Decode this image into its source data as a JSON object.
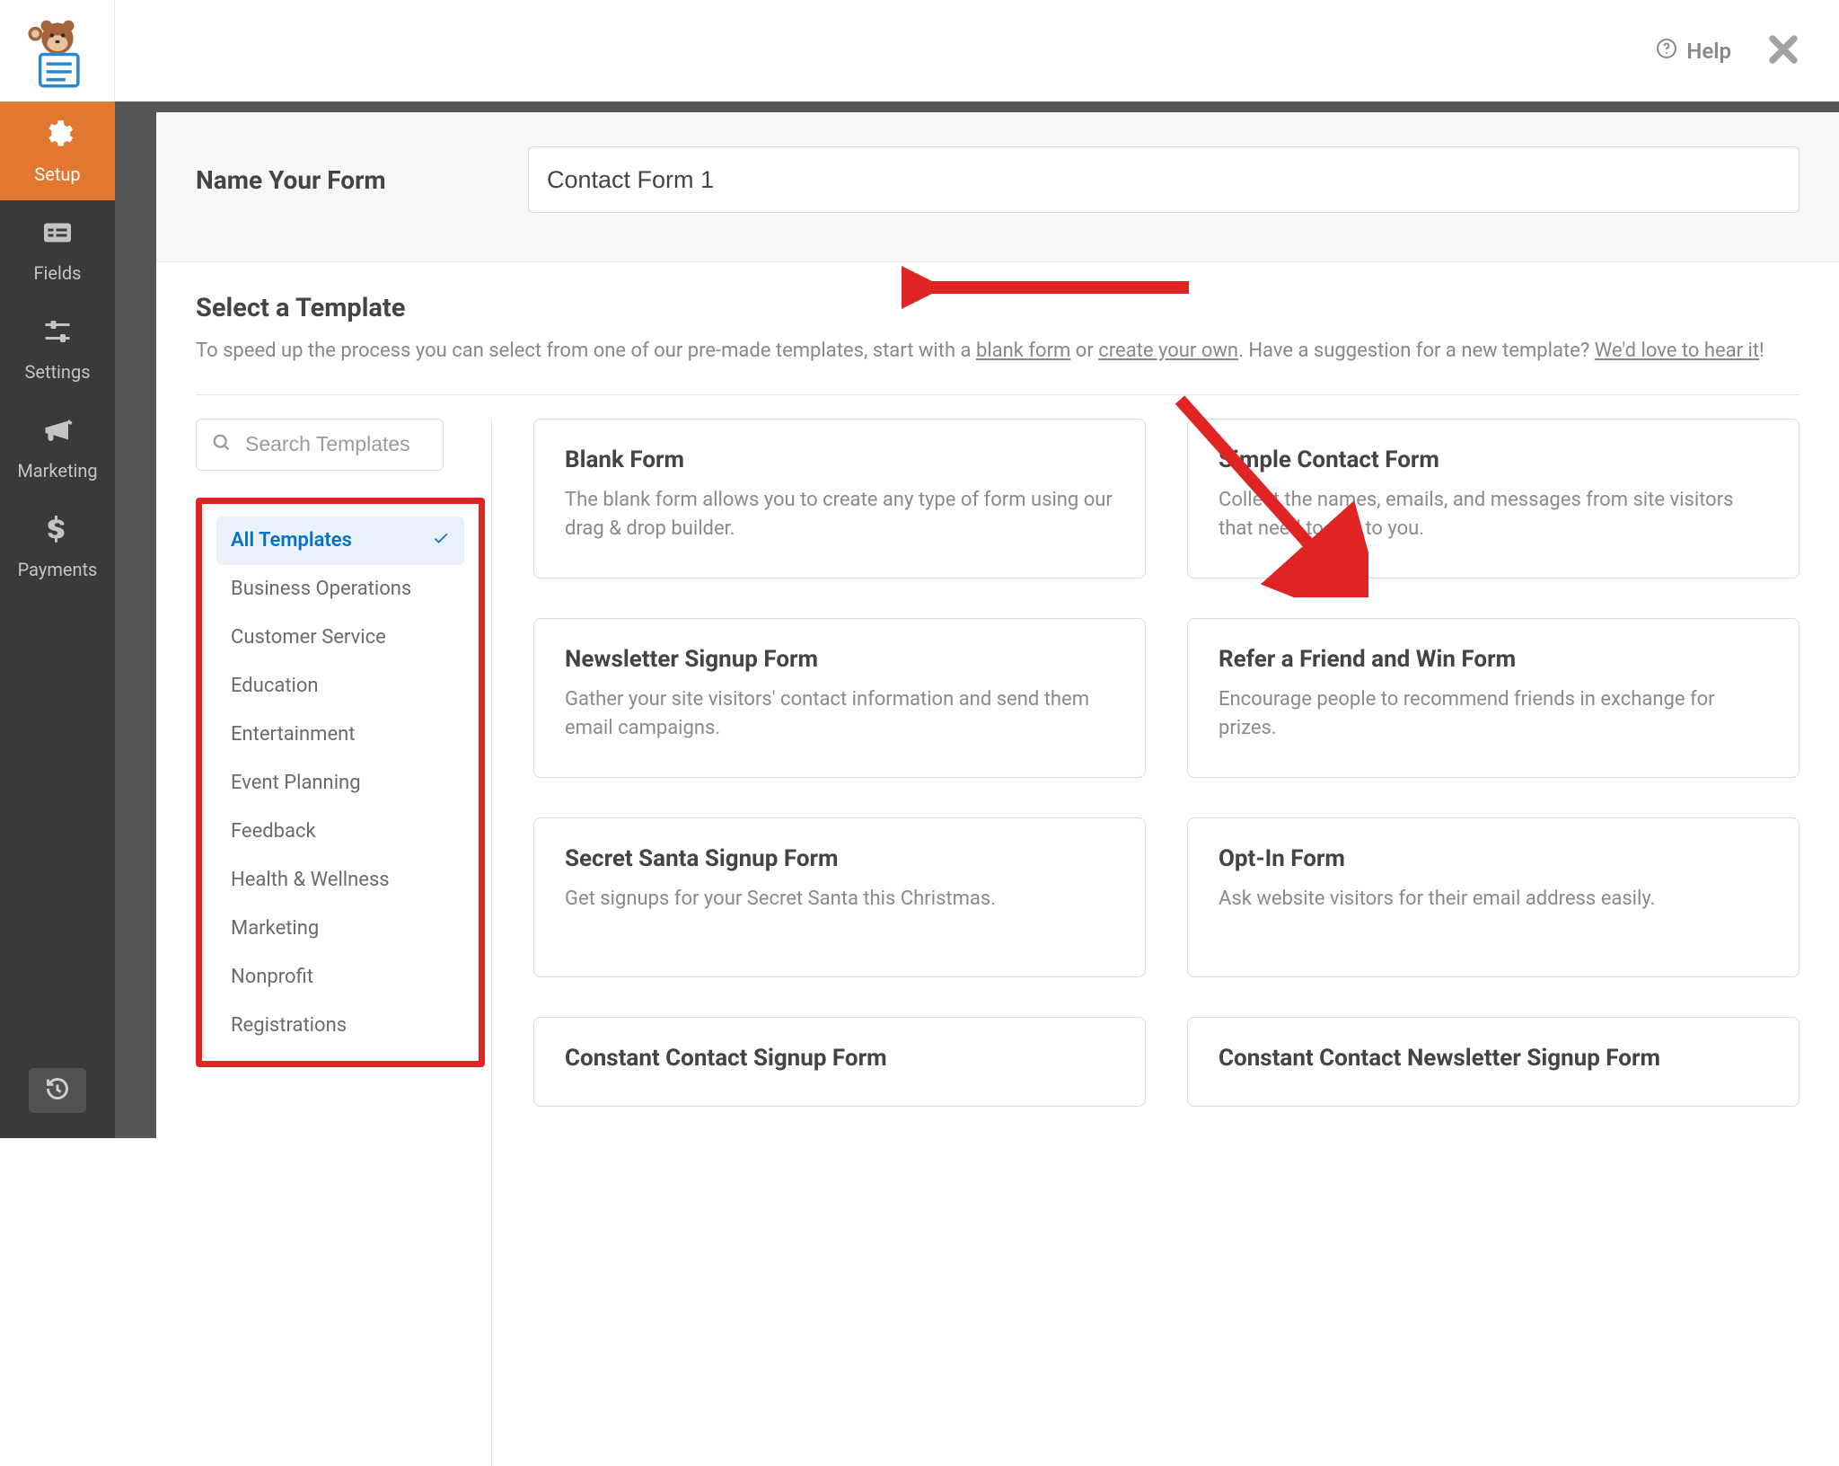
{
  "header": {
    "help_label": "Help"
  },
  "sidebar": {
    "items": [
      {
        "label": "Setup"
      },
      {
        "label": "Fields"
      },
      {
        "label": "Settings"
      },
      {
        "label": "Marketing"
      },
      {
        "label": "Payments"
      }
    ]
  },
  "form_name": {
    "label": "Name Your Form",
    "value": "Contact Form 1"
  },
  "template_section": {
    "heading": "Select a Template",
    "sub_pre": "To speed up the process you can select from one of our pre-made templates, start with a ",
    "sub_link1": "blank form",
    "sub_mid": " or ",
    "sub_link2": "create your own",
    "sub_post": ". Have a suggestion for a new template? ",
    "sub_link3": "We'd love to hear it",
    "sub_end": "!"
  },
  "search": {
    "placeholder": "Search Templates"
  },
  "categories": [
    "All Templates",
    "Business Operations",
    "Customer Service",
    "Education",
    "Entertainment",
    "Event Planning",
    "Feedback",
    "Health & Wellness",
    "Marketing",
    "Nonprofit",
    "Registrations"
  ],
  "templates": [
    {
      "title": "Blank Form",
      "desc": "The blank form allows you to create any type of form using our drag & drop builder."
    },
    {
      "title": "Simple Contact Form",
      "desc": "Collect the names, emails, and messages from site visitors that need to talk to you."
    },
    {
      "title": "Newsletter Signup Form",
      "desc": "Gather your site visitors' contact information and send them email campaigns."
    },
    {
      "title": "Refer a Friend and Win Form",
      "desc": "Encourage people to recommend friends in exchange for prizes."
    },
    {
      "title": "Secret Santa Signup Form",
      "desc": "Get signups for your Secret Santa this Christmas."
    },
    {
      "title": "Opt-In Form",
      "desc": "Ask website visitors for their email address easily."
    },
    {
      "title": "Constant Contact Signup Form",
      "desc": ""
    },
    {
      "title": "Constant Contact Newsletter Signup Form",
      "desc": ""
    }
  ]
}
